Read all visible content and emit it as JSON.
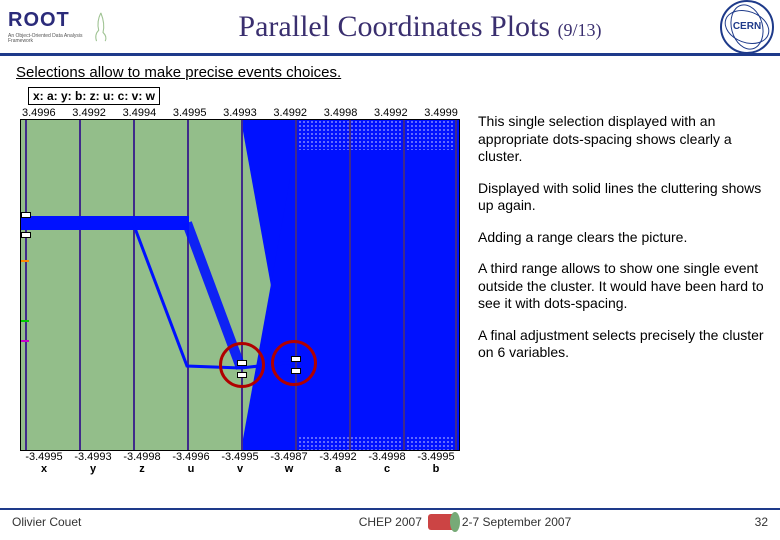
{
  "header": {
    "root_label": "ROOT",
    "root_tagline": "An Object-Oriented Data Analysis Framework",
    "title": "Parallel Coordinates Plots",
    "counter": "(9/13)",
    "cern_label": "CERN"
  },
  "subtitle": "Selections allow to make precise events choices.",
  "axis_expression": "x: a: y: b: z: u: c: v: w",
  "paragraphs": {
    "p1": "This single selection displayed with an appropriate dots-spacing shows clearly a cluster.",
    "p2": "Displayed with solid lines the cluttering shows up again.",
    "p3": "Adding a range clears the picture.",
    "p4": "A third range allows to show one single event outside the cluster. It would have been hard to see it with dots-spacing.",
    "p5": "A final adjustment selects precisely the cluster on 6 variables."
  },
  "footer": {
    "author": "Olivier Couet",
    "conference": "CHEP 2007",
    "dates": "2-7 September 2007",
    "page": "32"
  },
  "chart_data": {
    "type": "parallel-coordinates",
    "axes": [
      {
        "name": "x",
        "top": 3.4996,
        "bottom": -3.4995
      },
      {
        "name": "y",
        "top": 3.4992,
        "bottom": -3.4993
      },
      {
        "name": "z",
        "top": 3.4994,
        "bottom": -3.4998
      },
      {
        "name": "u",
        "top": 3.4995,
        "bottom": -3.4996
      },
      {
        "name": "v",
        "top": 3.4993,
        "bottom": -3.4995
      },
      {
        "name": "w",
        "top": 3.4992,
        "bottom": -3.4987
      },
      {
        "name": "a",
        "top": 3.4998,
        "bottom": -3.4992
      },
      {
        "name": "c",
        "top": 3.4992,
        "bottom": -3.4998
      },
      {
        "name": "b",
        "top": 3.4999,
        "bottom": -3.4995
      }
    ],
    "selection_ranges_on_axis_x": [
      {
        "approx_value_low": 1.35,
        "approx_value_high": 1.55
      }
    ],
    "highlight_circles_near_axes": [
      "v",
      "w"
    ],
    "cluster_region": "dense solid blue fan from axes a,c,b spanning full range; narrow selected band near y≈1.4 across x..u then diverges"
  }
}
